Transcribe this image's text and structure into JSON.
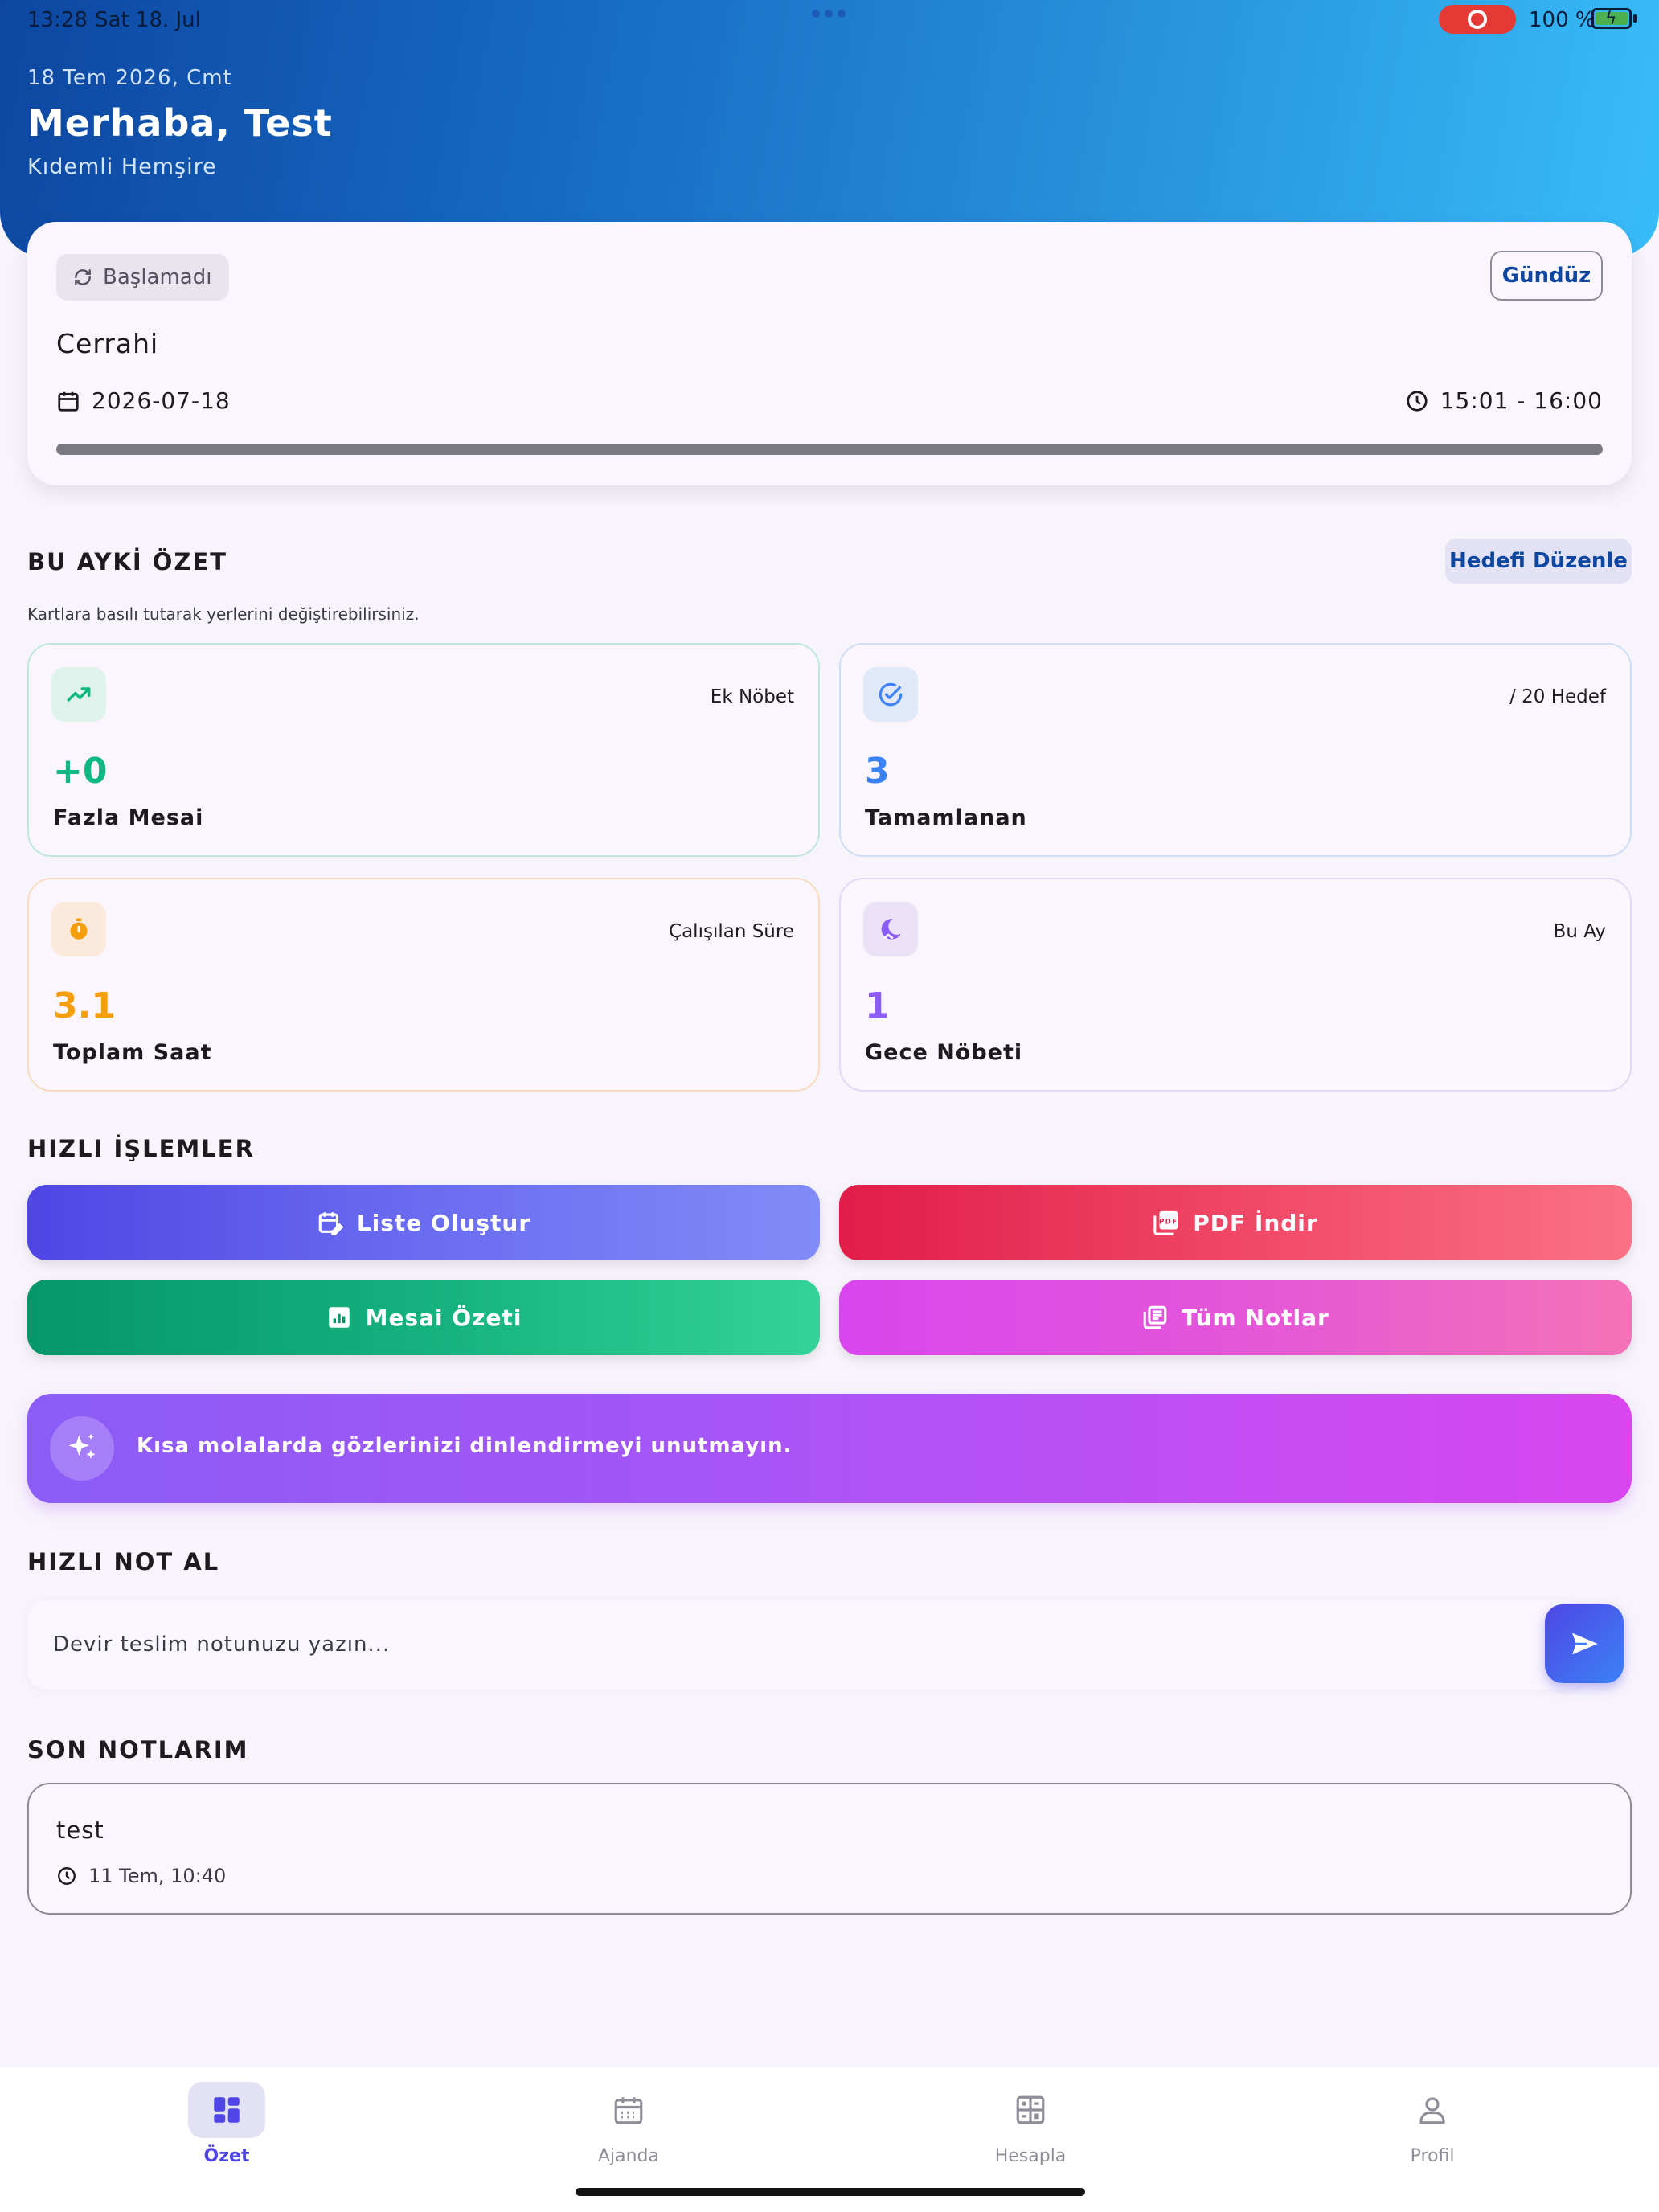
{
  "status_bar": {
    "time": "13:28",
    "date": "Sat 18. Jul",
    "battery": "100 %"
  },
  "header": {
    "date": "18 Tem 2026, Cmt",
    "greeting": "Merhaba, Test",
    "role": "Kıdemli Hemşire"
  },
  "shift": {
    "status": "Başlamadı",
    "shift_type": "Gündüz",
    "department": "Cerrahi",
    "date": "2026-07-18",
    "time_range": "15:01 - 16:00",
    "progress": 1.0
  },
  "summary": {
    "title": "BU AYKİ ÖZET",
    "edit_goal_label": "Hedefi Düzenle",
    "hint": "Kartlara basılı tutarak yerlerini değiştirebilirsiniz.",
    "cards": [
      {
        "icon": "trending-up-icon",
        "top_label": "Ek Nöbet",
        "value": "+0",
        "label": "Fazla Mesai",
        "color": "#10b981"
      },
      {
        "icon": "check-circle-icon",
        "top_label": "/ 20 Hedef",
        "value": "3",
        "label": "Tamamlanan",
        "color": "#3b82f6"
      },
      {
        "icon": "timer-icon",
        "top_label": "Çalışılan Süre",
        "value": "3.1",
        "label": "Toplam Saat",
        "color": "#f59e0b"
      },
      {
        "icon": "moon-icon",
        "top_label": "Bu Ay",
        "value": "1",
        "label": "Gece Nöbeti",
        "color": "#8b5cf6"
      }
    ]
  },
  "quick_actions": {
    "title": "HIZLI İŞLEMLER",
    "items": [
      {
        "label": "Liste Oluştur",
        "icon": "calendar-edit-icon"
      },
      {
        "label": "PDF İndir",
        "icon": "pdf-icon"
      },
      {
        "label": "Mesai Özeti",
        "icon": "bar-chart-icon"
      },
      {
        "label": "Tüm Notlar",
        "icon": "notes-icon"
      }
    ]
  },
  "tip": {
    "text": "Kısa molalarda gözlerinizi dinlendirmeyi unutmayın.",
    "icon": "sparkles-icon"
  },
  "quick_note": {
    "title": "HIZLI NOT AL",
    "placeholder": "Devir teslim notunuzu yazın..."
  },
  "recent_notes": {
    "title": "SON NOTLARIM",
    "items": [
      {
        "text": "test",
        "time": "11 Tem, 10:40"
      }
    ]
  },
  "bottom_nav": {
    "items": [
      {
        "label": "Özet",
        "icon": "dashboard-icon",
        "active": true
      },
      {
        "label": "Ajanda",
        "icon": "calendar-icon",
        "active": false
      },
      {
        "label": "Hesapla",
        "icon": "calculator-icon",
        "active": false
      },
      {
        "label": "Profil",
        "icon": "person-icon",
        "active": false
      }
    ]
  }
}
